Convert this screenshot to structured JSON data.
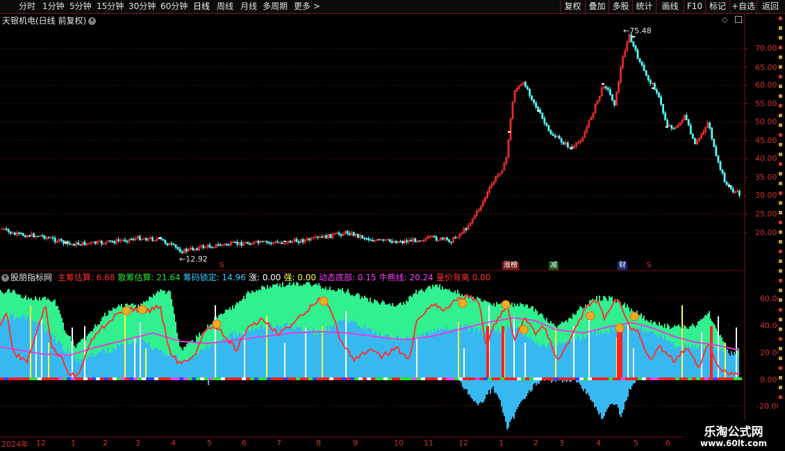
{
  "toolbar": {
    "periods": [
      "分时",
      "1分钟",
      "5分钟",
      "15分钟",
      "30分钟",
      "60分钟",
      "日线",
      "周线",
      "月线",
      "多周期",
      "更多"
    ],
    "active_period": "日线",
    "buttons": [
      "复权",
      "叠加",
      "多股",
      "统计",
      "画线",
      "F10",
      "标记",
      "+自选",
      "返回"
    ]
  },
  "main": {
    "title": "天银机电(日线 前复权)",
    "high_label": "75.48",
    "low_label": "12.92",
    "yaxis_ticks": [
      "70.00",
      "65.00",
      "60.00",
      "55.00",
      "50.00",
      "45.00",
      "40.00",
      "35.00",
      "30.00",
      "25.00",
      "20.00"
    ],
    "events": [
      "S",
      "S",
      "涨榜",
      "减",
      "财",
      "S"
    ]
  },
  "indicator": {
    "name": "股朋指标网",
    "items": [
      {
        "label": "主筹估算:",
        "value": "6.68",
        "color": "#ff3030"
      },
      {
        "label": "散筹估算:",
        "value": "21.64",
        "color": "#30e030"
      },
      {
        "label": "筹码锁定:",
        "value": "14.96",
        "color": "#3cc8ff"
      },
      {
        "label": "涨:",
        "value": "0.00",
        "color": "#ffffff"
      },
      {
        "label": "强:",
        "value": "0.00",
        "color": "#ffff40"
      },
      {
        "label": "动态底部:",
        "value": "0.15",
        "color": "#ff40ff"
      },
      {
        "label": "牛熊线:",
        "value": "20.24",
        "color": "#ff40ff"
      },
      {
        "label": "量价背离",
        "value": "0.00",
        "color": "#ff3030"
      }
    ],
    "yaxis_ticks": [
      "60.00",
      "40.00",
      "20.00",
      "0.00",
      "-20.00"
    ]
  },
  "xaxis": {
    "labels": [
      "2024年",
      "12",
      "1",
      "2",
      "3",
      "4",
      "5",
      "6",
      "7",
      "8",
      "9",
      "10",
      "11",
      "12",
      "1",
      "2",
      "3",
      "4",
      "5",
      "6"
    ]
  },
  "watermark": {
    "line1": "乐淘公式网",
    "line2": "www.60lt.com"
  },
  "colors": {
    "up": "#ff3232",
    "down": "#54ffff",
    "grid": "#7a1414",
    "axis": "#d23232",
    "main_chip": "#ff3030",
    "retail_chip": "#30f090",
    "locked_chip": "#38b8f0",
    "bull_bear": "#e040e0"
  }
}
